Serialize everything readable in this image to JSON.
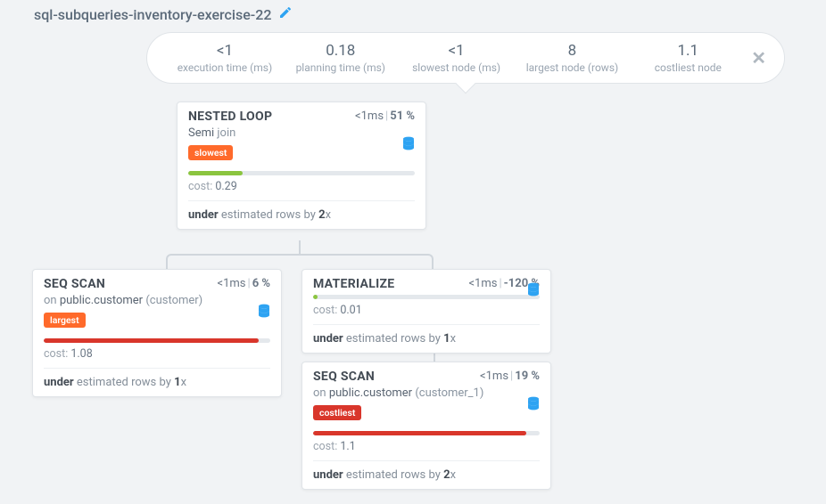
{
  "title": "sql-subqueries-inventory-exercise-22",
  "stats": [
    {
      "value": "<1",
      "label": "execution time (ms)"
    },
    {
      "value": "0.18",
      "label": "planning time (ms)"
    },
    {
      "value": "<1",
      "label": "slowest node (ms)"
    },
    {
      "value": "8",
      "label": "largest node (rows)"
    },
    {
      "value": "1.1",
      "label": "costliest node"
    }
  ],
  "nodes": {
    "n1": {
      "title": "NESTED LOOP",
      "time": "<1ms",
      "pct": "51 %",
      "sub_dark": "Semi",
      "sub_light": "join",
      "badge": "slowest",
      "badge_class": "slowest",
      "bar_class": "bar-green",
      "bar_pct": 24,
      "cost_label": "cost:",
      "cost_value": "0.29",
      "est_prefix": "under",
      "est_mid": "estimated rows by",
      "est_factor": "2",
      "est_suffix": "x"
    },
    "n2": {
      "title": "SEQ SCAN",
      "time": "<1ms",
      "pct": "6 %",
      "sub_light_pre": "on",
      "sub_dark": "public.customer",
      "sub_light_post": "(customer)",
      "badge": "largest",
      "badge_class": "largest",
      "bar_class": "bar-red",
      "bar_pct": 95,
      "cost_label": "cost:",
      "cost_value": "1.08",
      "est_prefix": "under",
      "est_mid": "estimated rows by",
      "est_factor": "1",
      "est_suffix": "x"
    },
    "n3": {
      "title": "MATERIALIZE",
      "time": "<1ms",
      "pct": "-120 %",
      "bar_class": "bar-green",
      "bar_pct": 2,
      "cost_label": "cost:",
      "cost_value": "0.01",
      "est_prefix": "under",
      "est_mid": "estimated rows by",
      "est_factor": "1",
      "est_suffix": "x"
    },
    "n4": {
      "title": "SEQ SCAN",
      "time": "<1ms",
      "pct": "19 %",
      "sub_light_pre": "on",
      "sub_dark": "public.customer",
      "sub_light_post": "(customer_1)",
      "badge": "costliest",
      "badge_class": "costliest",
      "bar_class": "bar-red",
      "bar_pct": 94,
      "cost_label": "cost:",
      "cost_value": "1.1",
      "est_prefix": "under",
      "est_mid": "estimated rows by",
      "est_factor": "2",
      "est_suffix": "x"
    }
  }
}
